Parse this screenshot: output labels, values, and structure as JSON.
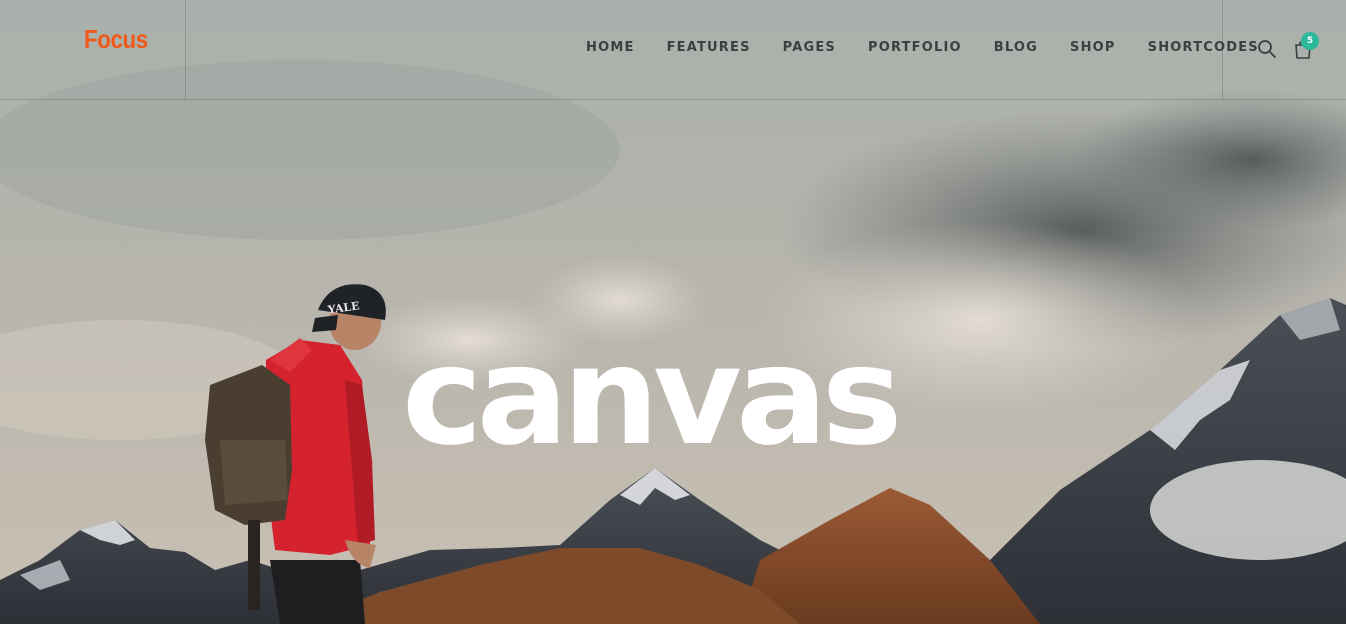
{
  "header": {
    "logo": "Focus",
    "nav": [
      "HOME",
      "FEATURES",
      "PAGES",
      "PORTFOLIO",
      "BLOG",
      "SHOP",
      "SHORTCODES"
    ],
    "cart_count": "5",
    "icons": {
      "search": "search-icon",
      "cart": "shopping-bag-icon"
    }
  },
  "hero": {
    "headline": "canvas",
    "cap_text": "YALE"
  },
  "colors": {
    "logo": "#ef5a1c",
    "badge": "#2bb89b",
    "nav_text": "#3b3f42",
    "jacket": "#d4232f"
  }
}
